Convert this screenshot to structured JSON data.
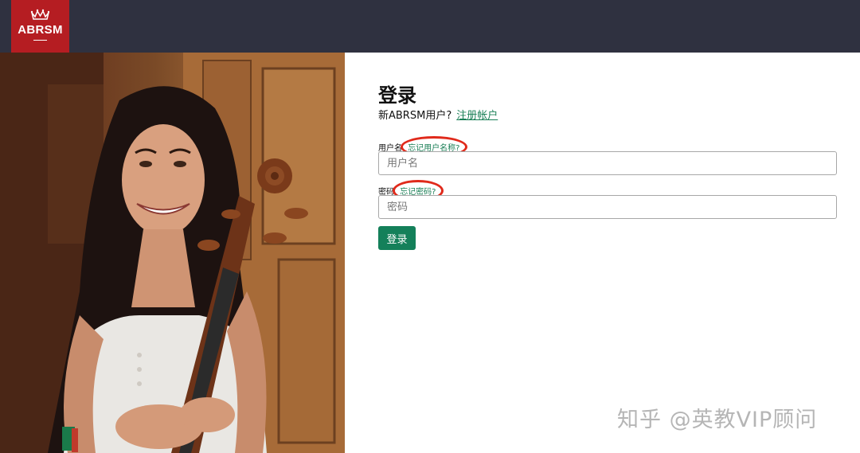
{
  "header": {
    "logo_text": "ABRSM",
    "background": "#2f3140",
    "logo_background": "#b51d22"
  },
  "login": {
    "title": "登录",
    "new_user_text": "新ABRSM用户?",
    "register_link": "注册帐户",
    "username_label": "用户名",
    "forgot_username": "忘记用户名称?",
    "username_placeholder": "用户名",
    "password_label": "密码",
    "forgot_password": "忘记密码?",
    "password_placeholder": "密码",
    "submit_label": "登录",
    "accent_color": "#14805a",
    "annotation_color": "#e02a1b"
  },
  "watermark": "知乎 @英教VIP顾问",
  "photo": {
    "icon": "cellist-photo"
  }
}
